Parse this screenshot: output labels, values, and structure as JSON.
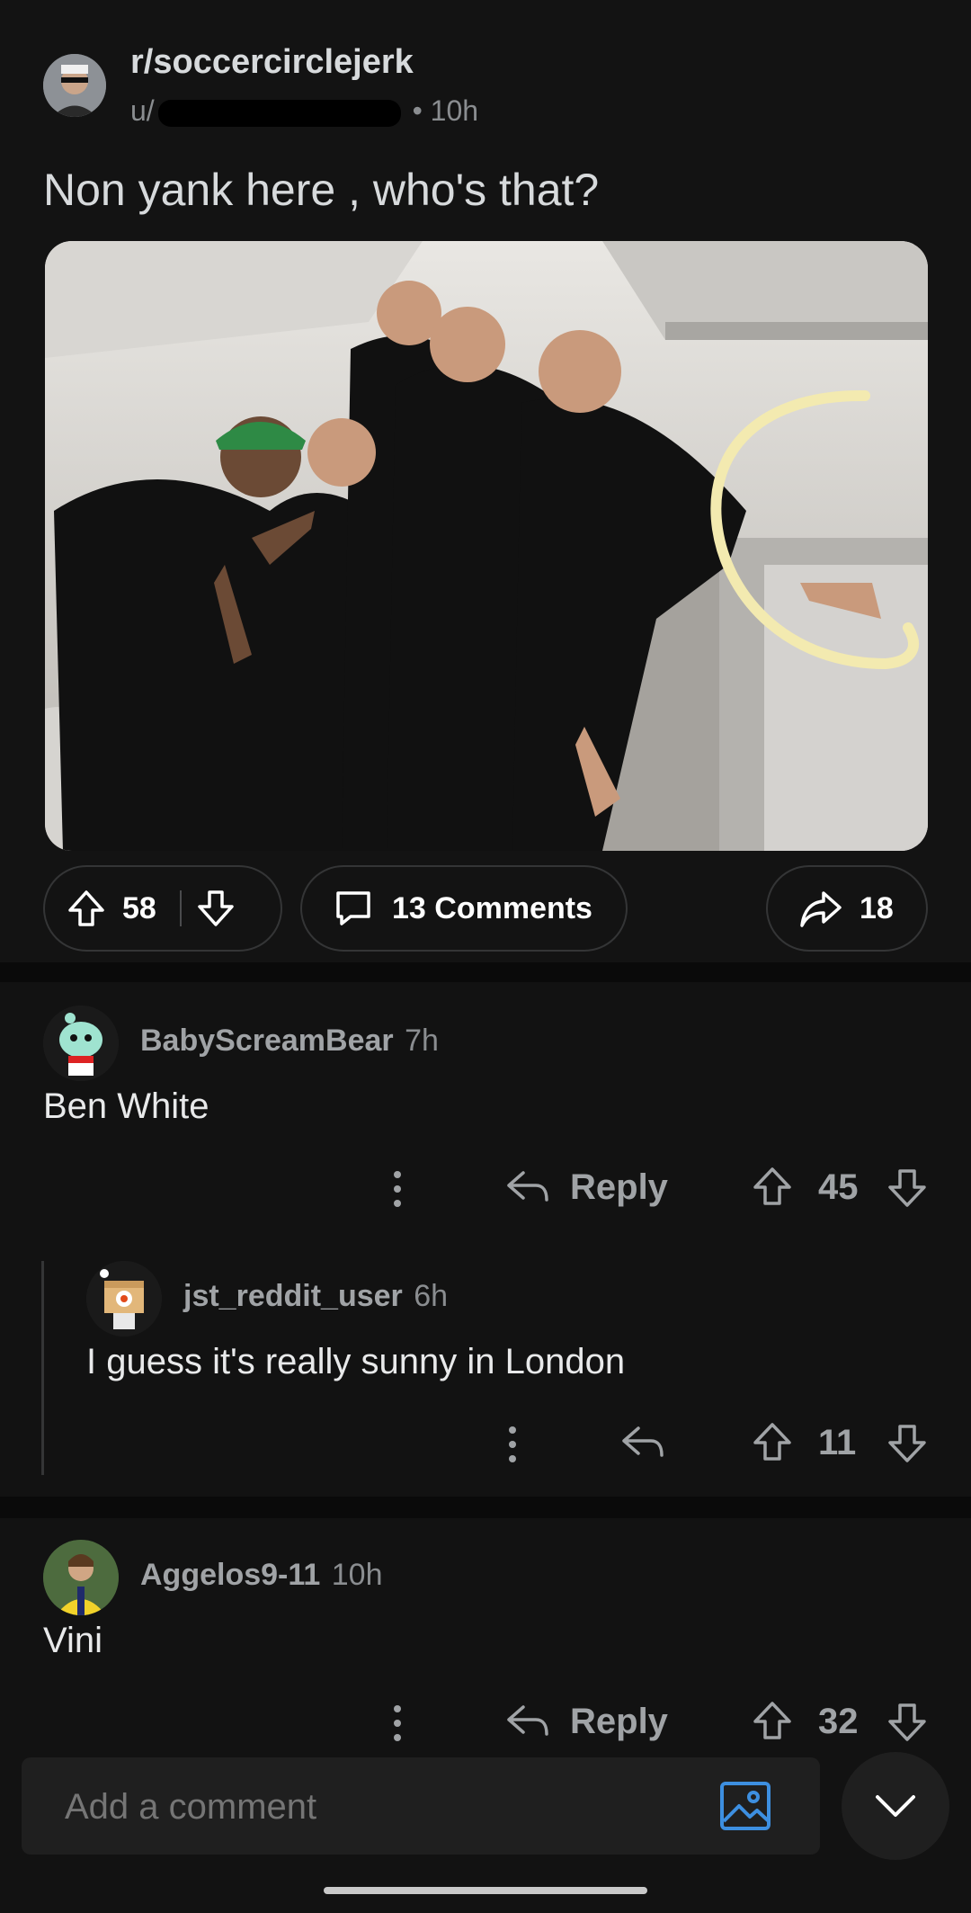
{
  "post": {
    "subreddit": "r/soccercirclejerk",
    "author": "u/",
    "time": "10h",
    "title": "Non yank here , who's that?",
    "upvotes": "58",
    "comments_label": "13 Comments",
    "shares": "18"
  },
  "comments": [
    {
      "username": "BabyScreamBear",
      "time": "7h",
      "text": "Ben White",
      "reply_label": "Reply",
      "score": "45"
    },
    {
      "username": "jst_reddit_user",
      "time": "6h",
      "text": "I guess it's really sunny in London",
      "score": "11"
    },
    {
      "username": "Aggelos9-11",
      "time": "10h",
      "text": "Vini",
      "reply_label": "Reply",
      "score": "32"
    }
  ],
  "composer": {
    "placeholder": "Add a comment"
  },
  "colors": {
    "background": "#121212",
    "accent_blue": "#3d8fe0",
    "redaction": "#000000"
  }
}
